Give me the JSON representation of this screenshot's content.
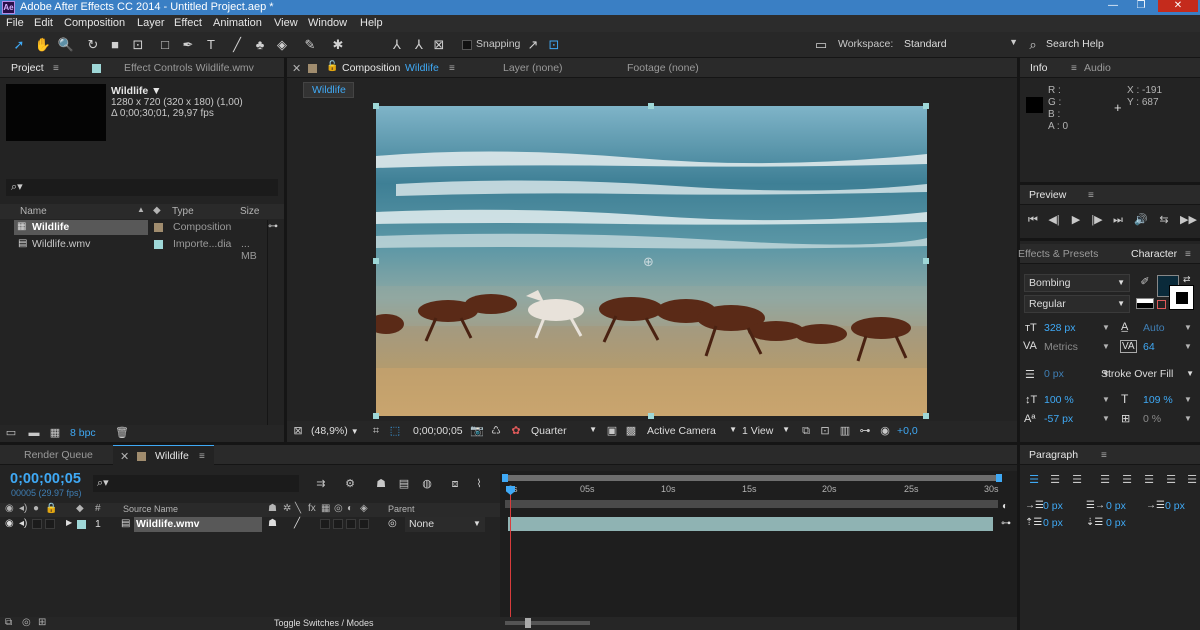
{
  "window": {
    "title": "Adobe After Effects CC 2014 - Untitled Project.aep *",
    "app_icon": "Ae",
    "controls": [
      "—",
      "❐",
      "✕"
    ]
  },
  "menu": [
    "File",
    "Edit",
    "Composition",
    "Layer",
    "Effect",
    "Animation",
    "View",
    "Window",
    "Help"
  ],
  "toolbar": {
    "snapping_label": "Snapping",
    "workspace_label": "Workspace:",
    "workspace_value": "Standard",
    "search_help": "Search Help"
  },
  "project": {
    "tab_project": "Project",
    "tab_effect_controls": "Effect Controls Wildlife.wmv",
    "item_name": "Wildlife ▼",
    "item_line1": "1280 x 720  (320 x 180) (1,00)",
    "item_line2": "Δ 0;00;30;01, 29,97 fps",
    "search_placeholder": "",
    "col_name": "Name",
    "col_type": "Type",
    "col_size": "Size",
    "items": [
      {
        "name": "Wildlife",
        "type": "Composition",
        "size": "",
        "color": "#a08c6e"
      },
      {
        "name": "Wildlife.wmv",
        "type": "Importe...dia",
        "size": "... MB",
        "color": "#9ed7d7"
      }
    ],
    "bpc": "8 bpc"
  },
  "composition": {
    "tab_comp_prefix": "Composition",
    "tab_comp_name": "Wildlife",
    "tab_layer": "Layer  (none)",
    "tab_footage": "Footage  (none)",
    "breadcrumb": "Wildlife",
    "zoom": "(48,9%)",
    "timecode": "0;00;00;05",
    "resolution": "Quarter",
    "camera": "Active Camera",
    "views": "1 View",
    "exposure": "+0,0"
  },
  "info": {
    "tab_info": "Info",
    "tab_audio": "Audio",
    "r": "R :",
    "g": "G :",
    "b": "B :",
    "a": "A : 0",
    "x": "X : -191",
    "y": "Y : 687"
  },
  "preview": {
    "tab": "Preview"
  },
  "character": {
    "tab_effects": "Effects & Presets",
    "tab_character": "Character",
    "font": "Bombing",
    "style": "Regular",
    "size": "328 px",
    "leading": "Auto",
    "kerning": "Metrics",
    "tracking": "64",
    "stroke_width": "0 px",
    "stroke_mode": "Stroke Over Fill",
    "vscale": "100 %",
    "hscale": "109 %",
    "baseline": "-57 px",
    "tsume": "0 %",
    "fill_color": "#0a2a3a"
  },
  "paragraph": {
    "tab": "Paragraph",
    "indent_left": "0 px",
    "indent_first": "0 px",
    "indent_right": "0 px",
    "space_before": "0 px",
    "space_after": "0 px"
  },
  "timeline": {
    "tab_render": "Render Queue",
    "tab_comp": "Wildlife",
    "timecode": "0;00;00;05",
    "frames": "00005 (29.97 fps)",
    "col_source": "Source Name",
    "col_parent": "Parent",
    "layer_index": "1",
    "layer_name": "Wildlife.wmv",
    "parent_value": "None",
    "ruler": [
      "0s",
      "05s",
      "10s",
      "15s",
      "20s",
      "25s",
      "30s"
    ],
    "toggle": "Toggle Switches / Modes"
  }
}
